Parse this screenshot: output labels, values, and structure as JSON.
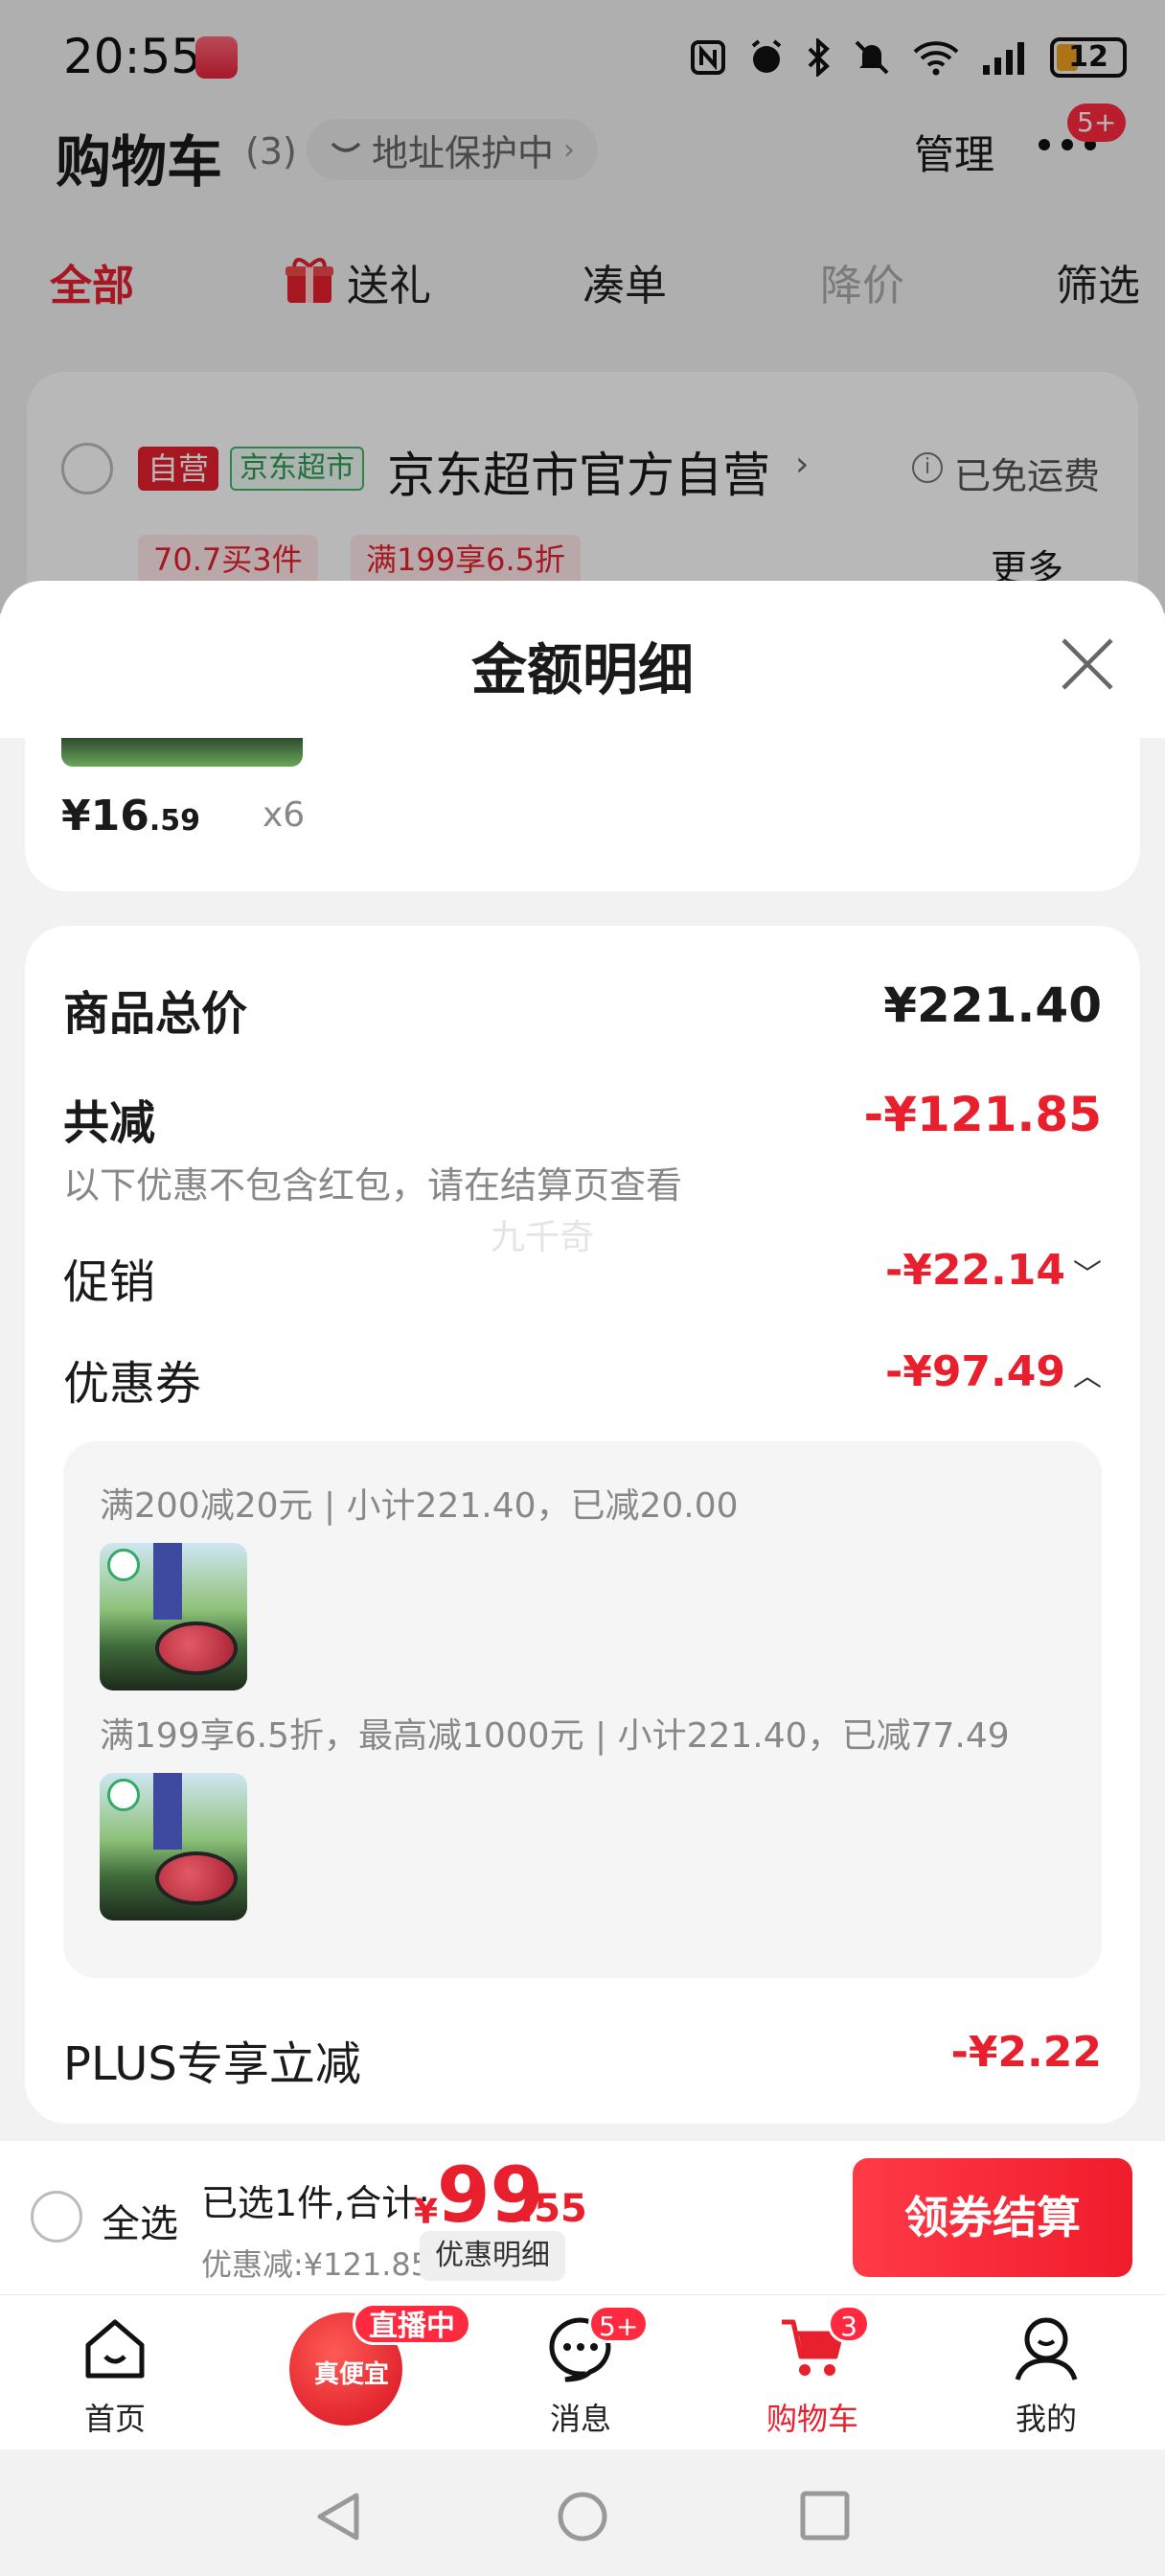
{
  "status_bar": {
    "time": "20:55",
    "battery": "12"
  },
  "header": {
    "title": "购物车",
    "count": "(3)",
    "address": "地址保护中",
    "manage": "管理",
    "more_badge": "5+"
  },
  "category_tabs": [
    "全部",
    "送礼",
    "凑单",
    "降价",
    "筛选"
  ],
  "store": {
    "self_tag": "自营",
    "market_tag": "京东超市",
    "name": "京东超市官方自营",
    "shipping": "已免运费",
    "promos": [
      "70.7买3件",
      "满199享6.5折"
    ],
    "more": "更多"
  },
  "sheet": {
    "title": "金额明细",
    "item": {
      "price_int": "¥16",
      "price_dec": ".59",
      "qty": "x6"
    },
    "total_label": "商品总价",
    "total_value": "¥221.40",
    "reduce_label": "共减",
    "reduce_value": "-¥121.85",
    "reduce_note": "以下优惠不包含红包，请在结算页查看",
    "promo_label": "促销",
    "promo_value": "-¥22.14",
    "coupon_label": "优惠券",
    "coupon_value": "-¥97.49",
    "coupon_lines": [
      "满200减20元 | 小计221.40，已减20.00",
      "满199享6.5折，最高减1000元 | 小计221.40，已减77.49"
    ],
    "plus_label": "PLUS专享立减",
    "plus_value": "-¥2.22",
    "watermark": "九千奇"
  },
  "checkout": {
    "select_all": "全选",
    "selected": "已选1件,合计:",
    "currency": "¥",
    "total_int": "99",
    "total_dec": ".55",
    "discount": "优惠减:¥121.85",
    "detail_button": "优惠明细",
    "checkout_button": "领券结算"
  },
  "tabbar": {
    "home": "首页",
    "live_badge": "直播中",
    "live_text": "真便宜",
    "messages": "消息",
    "messages_badge": "5+",
    "cart": "购物车",
    "cart_badge": "3",
    "me": "我的"
  },
  "colors": {
    "accent": "#e8202e",
    "background": "#f2f2f2"
  }
}
